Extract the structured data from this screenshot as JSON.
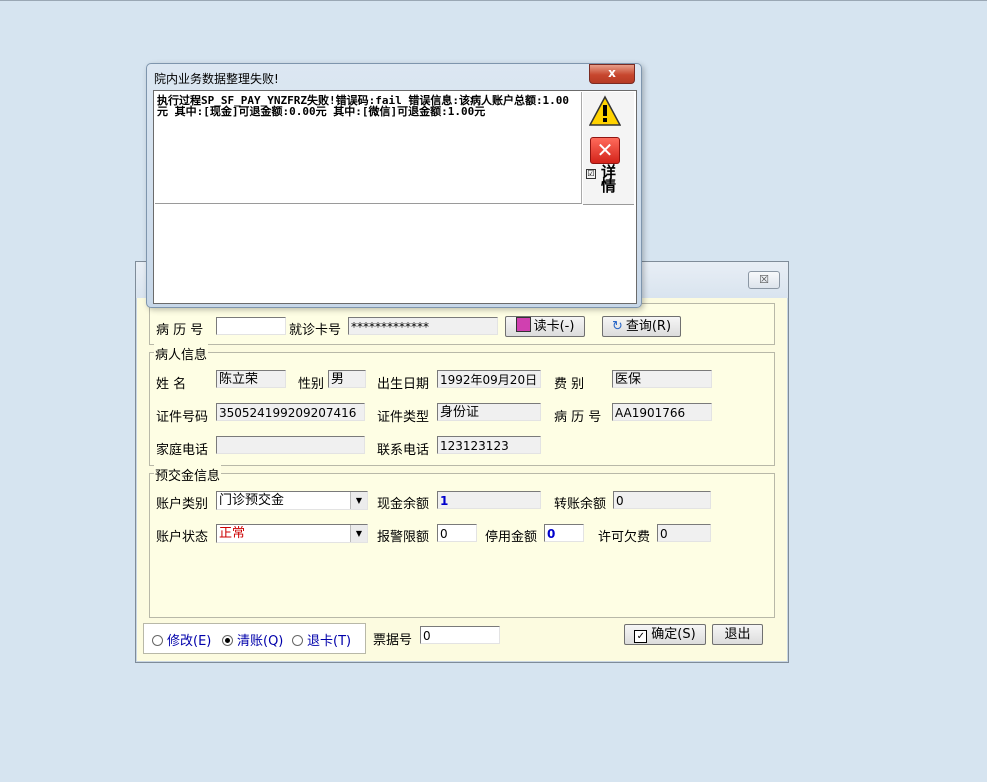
{
  "error_dialog": {
    "title": "院内业务数据整理失败!",
    "close_label": "x",
    "message": "执行过程SP_SF_PAY_YNZFRZ失败!错误码:fail 错误信息:该病人账户总额:1.00元  其中:[现金]可退金额:0.00元  其中:[微信]可退金额:1.00元",
    "detail_label": "详情",
    "detail_checked": "☑"
  },
  "main_dialog": {
    "close_label": "☒",
    "top": {
      "record_no_label": "病 历 号",
      "record_no_value": "",
      "card_label": "就诊卡号",
      "card_value": "*************",
      "read_card_button": "读卡(-)",
      "query_button": "查询(R)"
    },
    "patient": {
      "group_title": "病人信息",
      "name_label": "姓    名",
      "name_value": "陈立荣",
      "gender_label": "性别",
      "gender_value": "男",
      "birth_label": "出生日期",
      "birth_value": "1992年09月20日",
      "fee_type_label": "费    别",
      "fee_type_value": "医保",
      "id_no_label": "证件号码",
      "id_no_value": "350524199209207416",
      "id_type_label": "证件类型",
      "id_type_value": "身份证",
      "record_label": "病 历 号",
      "record_value": "AA1901766",
      "home_phone_label": "家庭电话",
      "home_phone_value": "",
      "contact_phone_label": "联系电话",
      "contact_phone_value": "123123123"
    },
    "deposit": {
      "group_title": "预交金信息",
      "account_type_label": "账户类别",
      "account_type_value": "门诊预交金",
      "cash_balance_label": "现金余额",
      "cash_balance_value": "1",
      "transfer_balance_label": "转账余额",
      "transfer_balance_value": "0",
      "account_status_label": "账户状态",
      "account_status_value": "正常",
      "alarm_label": "报警限额",
      "alarm_value": "0",
      "frozen_label": "停用金额",
      "frozen_value": "0",
      "overdraft_label": "许可欠费",
      "overdraft_value": "0"
    },
    "bottom": {
      "radio_modify": "修改(E)",
      "radio_clear": "清账(Q)",
      "radio_return": "退卡(T)",
      "ticket_label": "票据号",
      "ticket_value": "0",
      "ok_button": "确定(S)",
      "exit_button": "退出"
    },
    "status_color": "#cc0000"
  }
}
